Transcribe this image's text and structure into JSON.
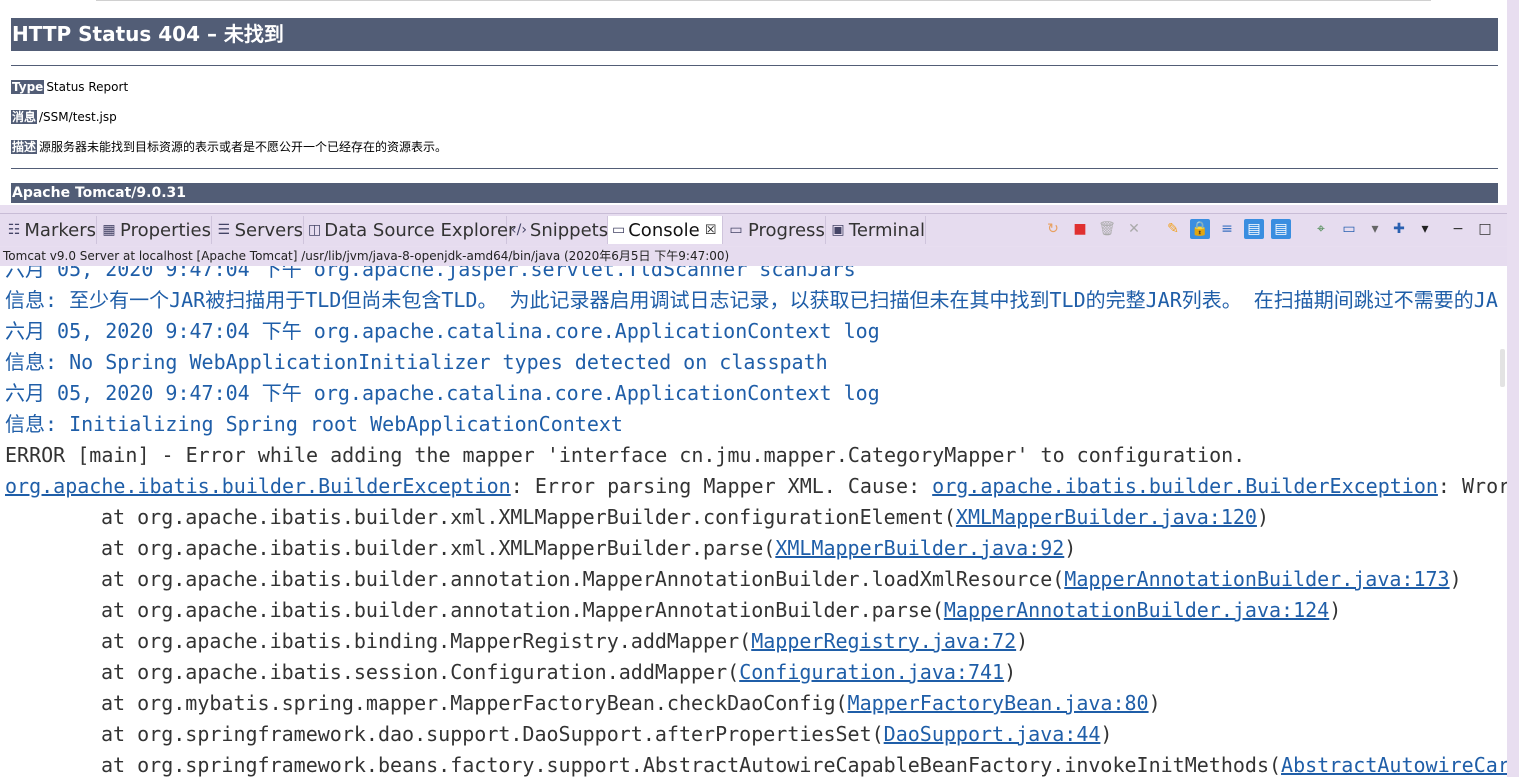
{
  "browser": {
    "heading": "HTTP Status 404 – 未找到",
    "rows": [
      {
        "label": "Type",
        "value": "Status Report"
      },
      {
        "label": "消息",
        "value": "/SSM/test.jsp"
      },
      {
        "label": "描述",
        "value": "源服务器未能找到目标资源的表示或者是不愿公开一个已经存在的资源表示。"
      }
    ],
    "footer": "Apache Tomcat/9.0.31"
  },
  "tabs": [
    {
      "label": "Markers",
      "icon": "markers-icon",
      "glyph": "☷"
    },
    {
      "label": "Properties",
      "icon": "properties-icon",
      "glyph": "▦"
    },
    {
      "label": "Servers",
      "icon": "servers-icon",
      "glyph": "☰"
    },
    {
      "label": "Data Source Explorer",
      "icon": "database-icon",
      "glyph": "◫"
    },
    {
      "label": "Snippets",
      "icon": "snippets-icon",
      "glyph": "‹/›"
    },
    {
      "label": "Console",
      "icon": "console-icon",
      "glyph": "▭",
      "active": true,
      "close": "☒"
    },
    {
      "label": "Progress",
      "icon": "progress-icon",
      "glyph": "▭"
    },
    {
      "label": "Terminal",
      "icon": "terminal-icon",
      "glyph": "▣"
    }
  ],
  "toolbar": [
    {
      "name": "restart-icon",
      "glyph": "↻",
      "color": "#e8a060"
    },
    {
      "name": "terminate-icon",
      "glyph": "■",
      "color": "#e03030"
    },
    {
      "name": "remove-launch-icon",
      "glyph": "🗑",
      "color": "#aaaaaa"
    },
    {
      "name": "remove-all-icon",
      "glyph": "✕",
      "color": "#aaaaaa"
    },
    {
      "name": "clear-console-icon",
      "glyph": "✎",
      "color": "#f0a020"
    },
    {
      "name": "scroll-lock-icon",
      "glyph": "🔒",
      "color": "#333333",
      "pressed": true
    },
    {
      "name": "word-wrap-icon",
      "glyph": "≡",
      "color": "#3a70c0"
    },
    {
      "name": "show-stdout-icon",
      "glyph": "▤",
      "color": "#ffffff",
      "pressed": true
    },
    {
      "name": "show-stderr-icon",
      "glyph": "▤",
      "color": "#ffffff",
      "pressed": true
    },
    {
      "name": "pin-console-icon",
      "glyph": "⌖",
      "color": "#3a8040"
    },
    {
      "name": "display-console-icon",
      "glyph": "▭",
      "color": "#2a60b0"
    },
    {
      "name": "display-console-menu-icon",
      "glyph": "▾",
      "color": "#666666"
    },
    {
      "name": "new-console-icon",
      "glyph": "✚",
      "color": "#2a60b0"
    },
    {
      "name": "view-menu-icon",
      "glyph": "▾",
      "color": "#222222"
    },
    {
      "name": "minimize-icon",
      "glyph": "−",
      "color": "#333333"
    },
    {
      "name": "maximize-icon",
      "glyph": "□",
      "color": "#333333"
    }
  ],
  "console": {
    "label": "Tomcat v9.0 Server at localhost [Apache Tomcat] /usr/lib/jvm/java-8-openjdk-amd64/bin/java  (2020年6月5日 下午9:47:00)",
    "lines": [
      {
        "kind": "info",
        "text": "六月 05, 2020 9:47:04 下午 org.apache.jasper.servlet.TldScanner scanJars"
      },
      {
        "kind": "info",
        "text": "信息: 至少有一个JAR被扫描用于TLD但尚未包含TLD。 为此记录器启用调试日志记录，以获取已扫描但未在其中找到TLD的完整JAR列表。 在扫描期间跳过不需要的JA"
      },
      {
        "kind": "info",
        "text": "六月 05, 2020 9:47:04 下午 org.apache.catalina.core.ApplicationContext log"
      },
      {
        "kind": "info",
        "text": "信息: No Spring WebApplicationInitializer types detected on classpath"
      },
      {
        "kind": "info",
        "text": "六月 05, 2020 9:47:04 下午 org.apache.catalina.core.ApplicationContext log"
      },
      {
        "kind": "info",
        "text": "信息: Initializing Spring root WebApplicationContext"
      },
      {
        "kind": "err",
        "text": "ERROR [main] - Error while adding the mapper 'interface cn.jmu.mapper.CategoryMapper' to configuration."
      },
      {
        "kind": "err",
        "link": "org.apache.ibatis.builder.BuilderException",
        "pre": "",
        "mid": ": Error parsing Mapper XML. Cause: ",
        "link2": "org.apache.ibatis.builder.BuilderException",
        "post": ": Wror"
      },
      {
        "kind": "trace",
        "pre": "at org.apache.ibatis.builder.xml.XMLMapperBuilder.configurationElement(",
        "link": "XMLMapperBuilder.java:120",
        "post": ")"
      },
      {
        "kind": "trace",
        "pre": "at org.apache.ibatis.builder.xml.XMLMapperBuilder.parse(",
        "link": "XMLMapperBuilder.java:92",
        "post": ")"
      },
      {
        "kind": "trace",
        "pre": "at org.apache.ibatis.builder.annotation.MapperAnnotationBuilder.loadXmlResource(",
        "link": "MapperAnnotationBuilder.java:173",
        "post": ")"
      },
      {
        "kind": "trace",
        "pre": "at org.apache.ibatis.builder.annotation.MapperAnnotationBuilder.parse(",
        "link": "MapperAnnotationBuilder.java:124",
        "post": ")"
      },
      {
        "kind": "trace",
        "pre": "at org.apache.ibatis.binding.MapperRegistry.addMapper(",
        "link": "MapperRegistry.java:72",
        "post": ")"
      },
      {
        "kind": "trace",
        "pre": "at org.apache.ibatis.session.Configuration.addMapper(",
        "link": "Configuration.java:741",
        "post": ")"
      },
      {
        "kind": "trace",
        "pre": "at org.mybatis.spring.mapper.MapperFactoryBean.checkDaoConfig(",
        "link": "MapperFactoryBean.java:80",
        "post": ")"
      },
      {
        "kind": "trace",
        "pre": "at org.springframework.dao.support.DaoSupport.afterPropertiesSet(",
        "link": "DaoSupport.java:44",
        "post": ")"
      },
      {
        "kind": "trace",
        "pre": "at org.springframework.beans.factory.support.AbstractAutowireCapableBeanFactory.invokeInitMethods(",
        "link": "AbstractAutowireCar",
        "post": ""
      }
    ]
  }
}
